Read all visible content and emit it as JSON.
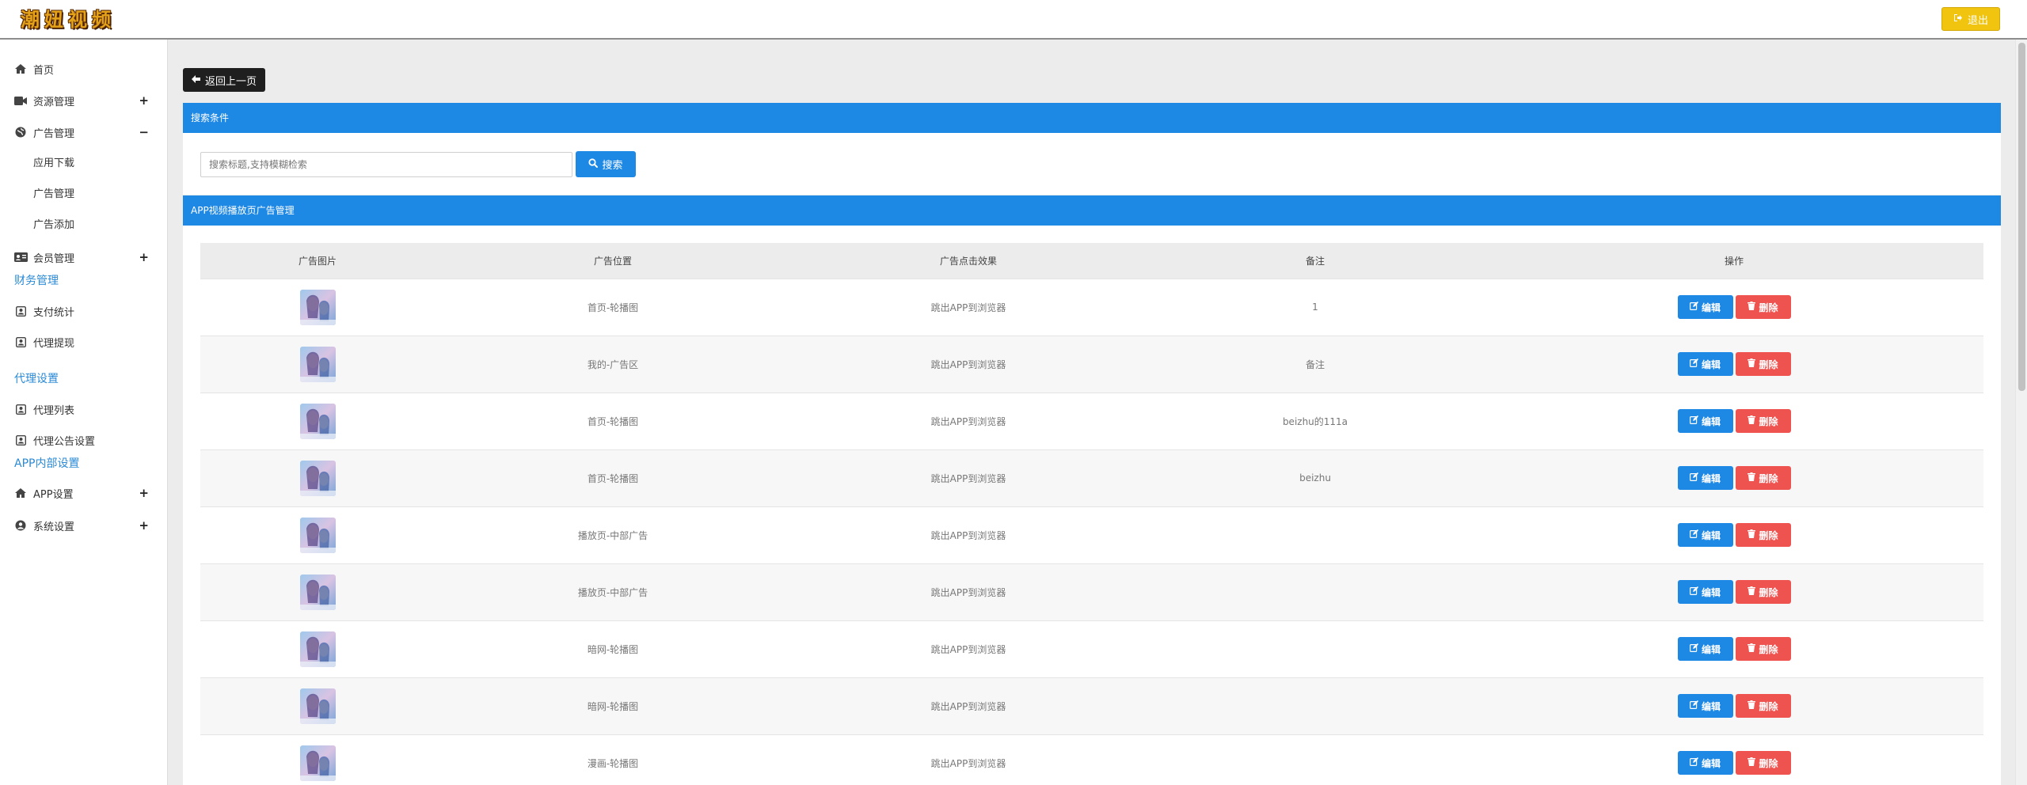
{
  "header": {
    "logo_chars": [
      "潮",
      "妞",
      "视",
      "频"
    ],
    "logout_label": "退出"
  },
  "sidebar": {
    "home": "首页",
    "resource": "资源管理",
    "ads": "广告管理",
    "ads_sub": [
      "应用下载",
      "广告管理",
      "广告添加"
    ],
    "member": "会员管理",
    "finance_section": "财务管理",
    "pay_stats": "支付统计",
    "agent_withdraw": "代理提现",
    "agent_section": "代理设置",
    "agent_list": "代理列表",
    "agent_notice": "代理公告设置",
    "app_section": "APP内部设置",
    "app_settings": "APP设置",
    "system_settings": "系统设置",
    "plus": "+",
    "minus": "−"
  },
  "main": {
    "back_label": "返回上一页",
    "search_panel_title": "搜索条件",
    "search_placeholder": "搜索标题,支持模糊检索",
    "search_button": "搜索",
    "list_panel_title": "APP视频播放页广告管理",
    "columns": [
      "广告图片",
      "广告位置",
      "广告点击效果",
      "备注",
      "操作"
    ],
    "edit_label": "编辑",
    "delete_label": "删除",
    "rows": [
      {
        "position": "首页-轮播图",
        "effect": "跳出APP到浏览器",
        "remark": "1"
      },
      {
        "position": "我的-广告区",
        "effect": "跳出APP到浏览器",
        "remark": "备注"
      },
      {
        "position": "首页-轮播图",
        "effect": "跳出APP到浏览器",
        "remark": "beizhu的111a"
      },
      {
        "position": "首页-轮播图",
        "effect": "跳出APP到浏览器",
        "remark": "beizhu"
      },
      {
        "position": "播放页-中部广告",
        "effect": "跳出APP到浏览器",
        "remark": ""
      },
      {
        "position": "播放页-中部广告",
        "effect": "跳出APP到浏览器",
        "remark": ""
      },
      {
        "position": "暗网-轮播图",
        "effect": "跳出APP到浏览器",
        "remark": ""
      },
      {
        "position": "暗网-轮播图",
        "effect": "跳出APP到浏览器",
        "remark": ""
      },
      {
        "position": "漫画-轮播图",
        "effect": "跳出APP到浏览器",
        "remark": ""
      }
    ]
  },
  "colors": {
    "primary": "#1e88e5",
    "danger": "#ef5350",
    "warning": "#f1c40f",
    "section_text": "#2a8ad6"
  },
  "icons": [
    "home-icon",
    "video-icon",
    "globe-icon",
    "id-card-icon",
    "user-square-icon",
    "user-circle-icon",
    "arrow-left-icon",
    "search-icon",
    "edit-icon",
    "trash-icon",
    "sign-out-icon"
  ]
}
